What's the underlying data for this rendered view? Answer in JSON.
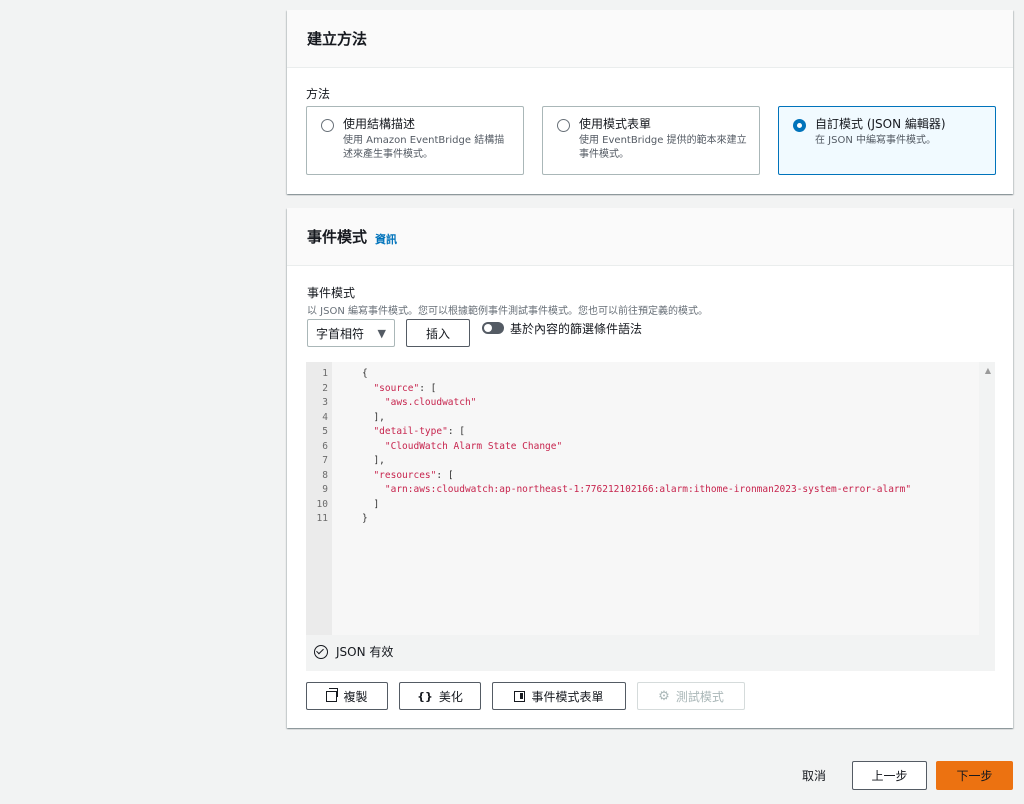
{
  "method_panel": {
    "title": "建立方法",
    "field_label": "方法",
    "options": [
      {
        "title": "使用結構描述",
        "desc": "使用 Amazon EventBridge 結構描述來產生事件模式。",
        "selected": false
      },
      {
        "title": "使用模式表單",
        "desc": "使用 EventBridge 提供的範本來建立事件模式。",
        "selected": false
      },
      {
        "title": "自訂模式 (JSON 編輯器)",
        "desc": "在 JSON 中編寫事件模式。",
        "selected": true
      }
    ]
  },
  "pattern_panel": {
    "title": "事件模式",
    "info_link": "資訊",
    "field_label": "事件模式",
    "field_desc": "以 JSON 編寫事件模式。您可以根據範例事件測試事件模式。您也可以前往預定義的模式。",
    "select_value": "字首相符",
    "insert_label": "插入",
    "toggle_label": "基於內容的篩選條件語法",
    "editor": {
      "line_numbers": [
        "1",
        "2",
        "3",
        "4",
        "5",
        "6",
        "7",
        "8",
        "9",
        "10",
        "11"
      ],
      "lines": [
        "{",
        "  \"source\": [",
        "    \"aws.cloudwatch\"",
        "  ],",
        "  \"detail-type\": [",
        "    \"CloudWatch Alarm State Change\"",
        "  ],",
        "  \"resources\": [",
        "    \"arn:aws:cloudwatch:ap-northeast-1:776212102166:alarm:ithome-ironman2023-system-error-alarm\"",
        "  ]",
        "}"
      ]
    },
    "valid_text": "JSON 有效",
    "buttons": {
      "copy": "複製",
      "beautify": "美化",
      "form": "事件模式表單",
      "test": "測試模式"
    }
  },
  "footer": {
    "cancel": "取消",
    "previous": "上一步",
    "next": "下一步"
  },
  "colors": {
    "primary": "#ec7211",
    "link": "#0073bb",
    "string": "#c7254e"
  }
}
